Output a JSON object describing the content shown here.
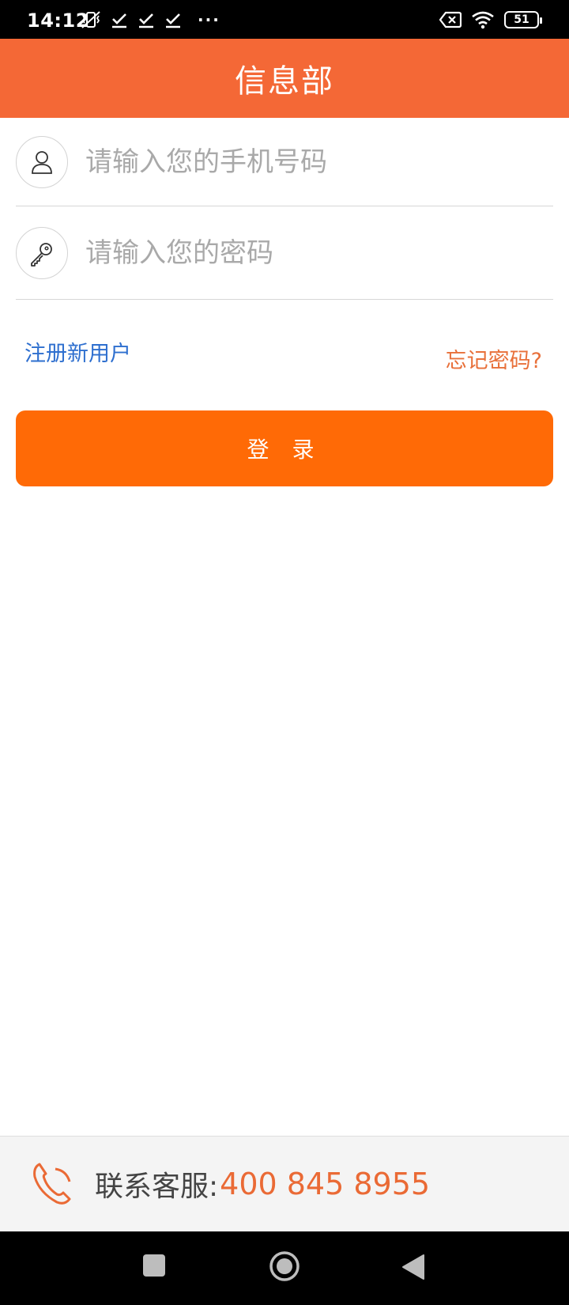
{
  "status_bar": {
    "time": "14:12",
    "overflow": "···",
    "battery": "51",
    "icons": [
      "vibrate-off-icon",
      "check-icon",
      "check-icon",
      "check-icon",
      "sim-error-icon",
      "wifi-icon",
      "battery-icon"
    ]
  },
  "header": {
    "title": "信息部",
    "background": "#f46836"
  },
  "login_form": {
    "phone_placeholder": "请输入您的手机号码",
    "phone_value": "",
    "password_placeholder": "请输入您的密码",
    "password_value": "",
    "register_label": "注册新用户",
    "forgot_label": "忘记密码?",
    "login_label": "登 录",
    "accent": "#ff6a06"
  },
  "footer": {
    "contact_label": "联系客服:",
    "contact_phone": "400 845 8955",
    "icon": "phone-icon"
  },
  "nav_bar": {
    "buttons": [
      "recent-apps-icon",
      "home-icon",
      "back-icon"
    ]
  }
}
